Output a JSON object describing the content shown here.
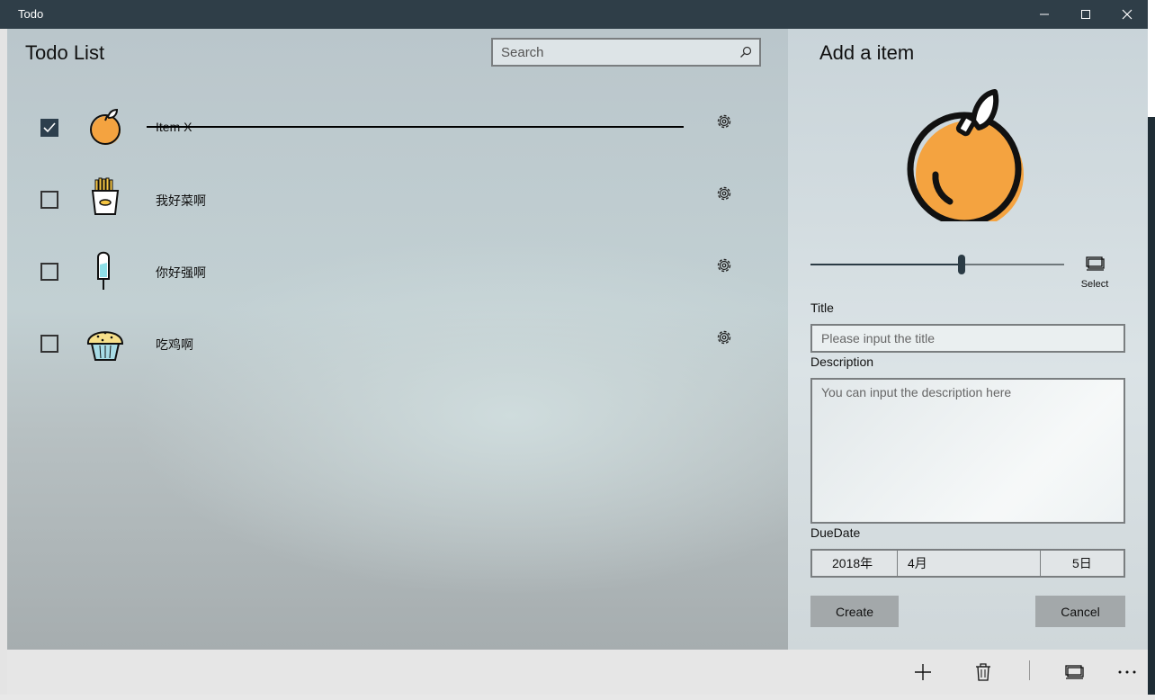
{
  "window": {
    "title": "Todo"
  },
  "list": {
    "title": "Todo List",
    "search_placeholder": "Search",
    "items": [
      {
        "title": "Item X",
        "checked": true,
        "icon": "orange-icon"
      },
      {
        "title": "我好菜啊",
        "checked": false,
        "icon": "fries-icon"
      },
      {
        "title": "你好强啊",
        "checked": false,
        "icon": "popsicle-icon"
      },
      {
        "title": "吃鸡啊",
        "checked": false,
        "icon": "muffin-icon"
      }
    ]
  },
  "form": {
    "heading": "Add a item",
    "preview_icon": "orange-icon",
    "slider_value": 0.6,
    "select_label": "Select",
    "title_label": "Title",
    "title_placeholder": "Please input the title",
    "description_label": "Description",
    "description_placeholder": "You can input the description here",
    "due_date_label": "DueDate",
    "due_date": {
      "year": "2018年",
      "month": "4月",
      "day": "5日"
    },
    "create_label": "Create",
    "cancel_label": "Cancel"
  },
  "command_bar": [
    "add-icon",
    "delete-icon",
    "select-icon",
    "more-icon"
  ],
  "colors": {
    "titlebar": "#2f3e48",
    "accent": "#2d3f4d",
    "orange": "#f4a340",
    "button": "#a3a8aa"
  }
}
